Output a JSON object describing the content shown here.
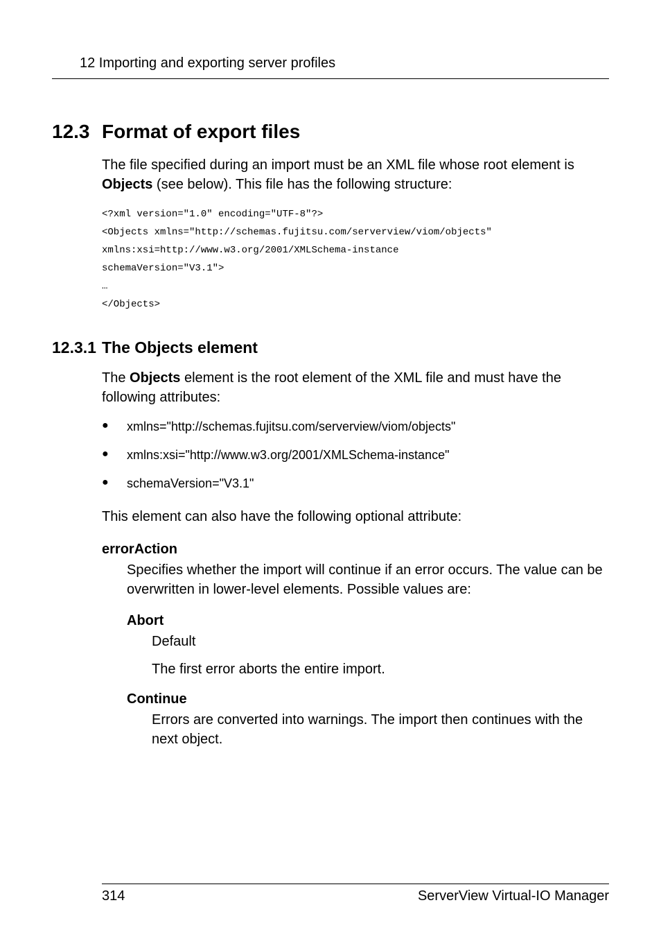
{
  "header": {
    "text": "12 Importing and exporting server profiles"
  },
  "section": {
    "number": "12.3",
    "title": "Format of export files",
    "intro_part1": "The file specified during an import must be an XML file whose root element is ",
    "intro_bold": "Objects",
    "intro_part2": " (see below). This file has the following structure:"
  },
  "code": {
    "line1": "<?xml version=\"1.0\" encoding=\"UTF-8\"?>",
    "line2": "<Objects xmlns=\"http://schemas.fujitsu.com/serverview/viom/objects\"",
    "line3": "xmlns:xsi=http://www.w3.org/2001/XMLSchema-instance",
    "line4": "schemaVersion=\"V3.1\">",
    "line5": "…",
    "line6": "</Objects>"
  },
  "subsection": {
    "number": "12.3.1",
    "title": "The Objects element",
    "intro_part1": "The ",
    "intro_bold": "Objects",
    "intro_part2": " element is the root element of the XML file and must have the following attributes:"
  },
  "bullets": {
    "item1": "xmlns=\"http://schemas.fujitsu.com/serverview/viom/objects\"",
    "item2": "xmlns:xsi=\"http://www.w3.org/2001/XMLSchema-instance\"",
    "item3": "schemaVersion=\"V3.1\""
  },
  "optional_text": "This element can also have the following optional attribute:",
  "errorAction": {
    "name": "errorAction",
    "desc": "Specifies whether the import will continue if an error occurs. The value can be overwritten in lower-level elements. Possible values are:",
    "abort": {
      "name": "Abort",
      "default": "Default",
      "desc": "The first error aborts the entire import."
    },
    "continue": {
      "name": "Continue",
      "desc": "Errors are converted into warnings. The import then continues with the next object."
    }
  },
  "footer": {
    "page": "314",
    "product": "ServerView Virtual-IO Manager"
  }
}
